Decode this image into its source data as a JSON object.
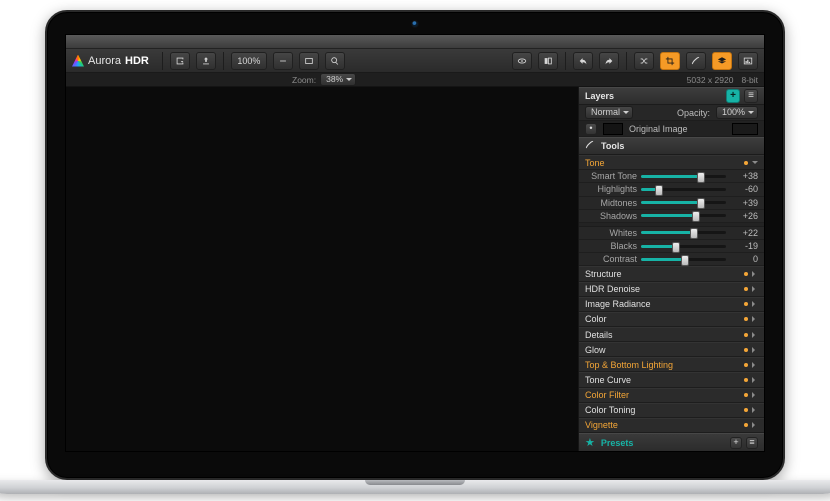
{
  "brand": {
    "thin": "Aurora",
    "bold": "HDR"
  },
  "toolbar": {
    "zoom_value": "100%",
    "icons": {
      "export": "export-icon",
      "share": "share-icon",
      "zoom_out": "minus-icon",
      "fit": "fit-screen-icon",
      "zoom_in": "search-icon",
      "eye": "eye-icon",
      "compare": "compare-icon",
      "undo": "undo-icon",
      "redo": "redo-icon",
      "shuffle": "shuffle-icon",
      "crop": "crop-icon",
      "brush": "brush-icon",
      "layers": "layers-icon",
      "histogram": "histogram-icon"
    }
  },
  "status": {
    "zoom_label": "Zoom:",
    "zoom_percent": "38%",
    "dimensions": "5032 x 2920",
    "bit_depth": "8-bit"
  },
  "layers": {
    "title": "Layers",
    "blend_mode": "Normal",
    "opacity_label": "Opacity:",
    "opacity_value": "100%",
    "layer0": "Original Image"
  },
  "tools": {
    "title": "Tools",
    "sections": [
      "Tone",
      "Structure",
      "HDR Denoise",
      "Image Radiance",
      "Color",
      "Details",
      "Glow",
      "Top & Bottom Lighting",
      "Tone Curve",
      "Color Filter",
      "Color Toning",
      "Vignette"
    ],
    "section_colors": [
      "orange",
      "white",
      "white",
      "white",
      "white",
      "white",
      "white",
      "orange",
      "white",
      "orange",
      "white",
      "orange"
    ],
    "tone_sliders": [
      {
        "label": "Smart Tone",
        "value": 38,
        "display": "+38"
      },
      {
        "label": "Highlights",
        "value": -60,
        "display": "-60"
      },
      {
        "label": "Midtones",
        "value": 39,
        "display": "+39"
      },
      {
        "label": "Shadows",
        "value": 26,
        "display": "+26"
      },
      {
        "label": "Whites",
        "value": 22,
        "display": "+22"
      },
      {
        "label": "Blacks",
        "value": -19,
        "display": "-19"
      },
      {
        "label": "Contrast",
        "value": 0,
        "display": "0"
      }
    ]
  },
  "presets": {
    "title": "Presets"
  }
}
